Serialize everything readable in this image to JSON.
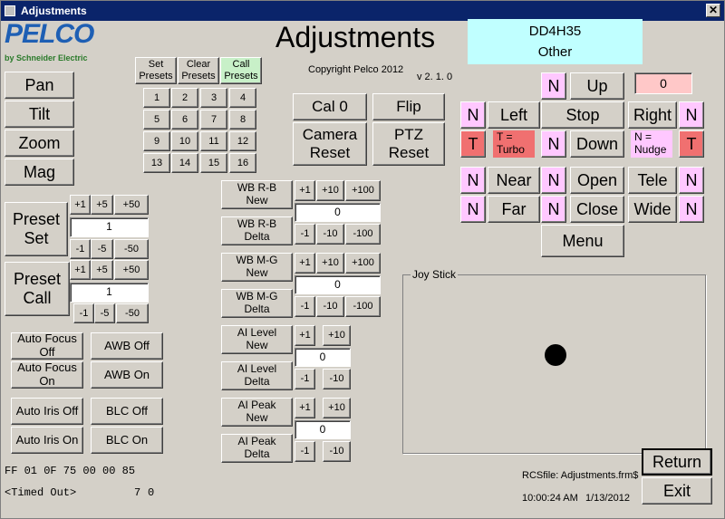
{
  "window": {
    "title": "Adjustments",
    "close_glyph": "✕"
  },
  "logo": {
    "brand": "PELCO",
    "sub": "by Schneider Electric"
  },
  "heading": "Adjustments",
  "copyright": "Copyright Pelco 2012",
  "version": "v 2. 1. 0",
  "camera": {
    "id": "DD4H35",
    "type": "Other"
  },
  "view": {
    "pan": "Pan",
    "tilt": "Tilt",
    "zoom": "Zoom",
    "mag": "Mag"
  },
  "presets": {
    "set_label": "Set\nPresets",
    "clear_label": "Clear\nPresets",
    "call_label": "Call\nPresets",
    "numbers": [
      "1",
      "2",
      "3",
      "4",
      "5",
      "6",
      "7",
      "8",
      "9",
      "10",
      "11",
      "12",
      "13",
      "14",
      "15",
      "16"
    ]
  },
  "actions": {
    "cal0": "Cal 0",
    "flip": "Flip",
    "camera_reset": "Camera\nReset",
    "ptz_reset": "PTZ\nReset"
  },
  "preset_set": {
    "label": "Preset\nSet",
    "inc": [
      "+1",
      "+5",
      "+50"
    ],
    "dec": [
      "-1",
      "-5",
      "-50"
    ],
    "value": "1"
  },
  "preset_call": {
    "label": "Preset\nCall",
    "inc": [
      "+1",
      "+5",
      "+50"
    ],
    "dec": [
      "-1",
      "-5",
      "-50"
    ],
    "value": "1"
  },
  "wb_rb": {
    "new_label": "WB R-B\nNew",
    "delta_label": "WB R-B\nDelta",
    "inc": [
      "+1",
      "+10",
      "+100"
    ],
    "dec": [
      "-1",
      "-10",
      "-100"
    ],
    "value": "0"
  },
  "wb_mg": {
    "new_label": "WB M-G\nNew",
    "delta_label": "WB M-G\nDelta",
    "inc": [
      "+1",
      "+10",
      "+100"
    ],
    "dec": [
      "-1",
      "-10",
      "-100"
    ],
    "value": "0"
  },
  "al_level": {
    "new_label": "AI Level\nNew",
    "delta_label": "AI Level\nDelta",
    "inc": [
      "+1",
      "+10"
    ],
    "dec": [
      "-1",
      "-10"
    ],
    "value": "0"
  },
  "al_peak": {
    "new_label": "AI Peak\nNew",
    "delta_label": "AI Peak\nDelta",
    "inc": [
      "+1",
      "+10"
    ],
    "dec": [
      "-1",
      "-10"
    ],
    "value": "0"
  },
  "toggles": {
    "af_off": "Auto Focus\nOff",
    "af_on": "Auto Focus\nOn",
    "awb_off": "AWB Off",
    "awb_on": "AWB On",
    "iris_off": "Auto Iris Off",
    "iris_on": "Auto Iris On",
    "blc_off": "BLC Off",
    "blc_on": "BLC On"
  },
  "status": {
    "hex": "FF 01 0F 75 00 00 85",
    "timed_out": "<Timed Out>",
    "count_a": "7",
    "count_b": "0"
  },
  "ptz": {
    "n": "N",
    "t": "T",
    "up": "Up",
    "left": "Left",
    "stop": "Stop",
    "right": "Right",
    "down": "Down",
    "counter": "0",
    "turbo_note": "T =\nTurbo",
    "nudge_note": "N =\nNudge",
    "near": "Near",
    "far": "Far",
    "open": "Open",
    "close": "Close",
    "tele": "Tele",
    "wide": "Wide",
    "menu": "Menu"
  },
  "joystick": {
    "label": "Joy Stick"
  },
  "footer": {
    "rcs": "RCSfile: Adjustments.frm$",
    "time": "10:00:24 AM",
    "date": "1/13/2012",
    "return": "Return",
    "exit": "Exit"
  },
  "colors": {
    "nudge": "#ffc8ff",
    "turbo": "#f07070",
    "camera_box": "#c0ffff",
    "counter_box": "#ffc8c8",
    "call_presets": "#c8f0c8"
  }
}
